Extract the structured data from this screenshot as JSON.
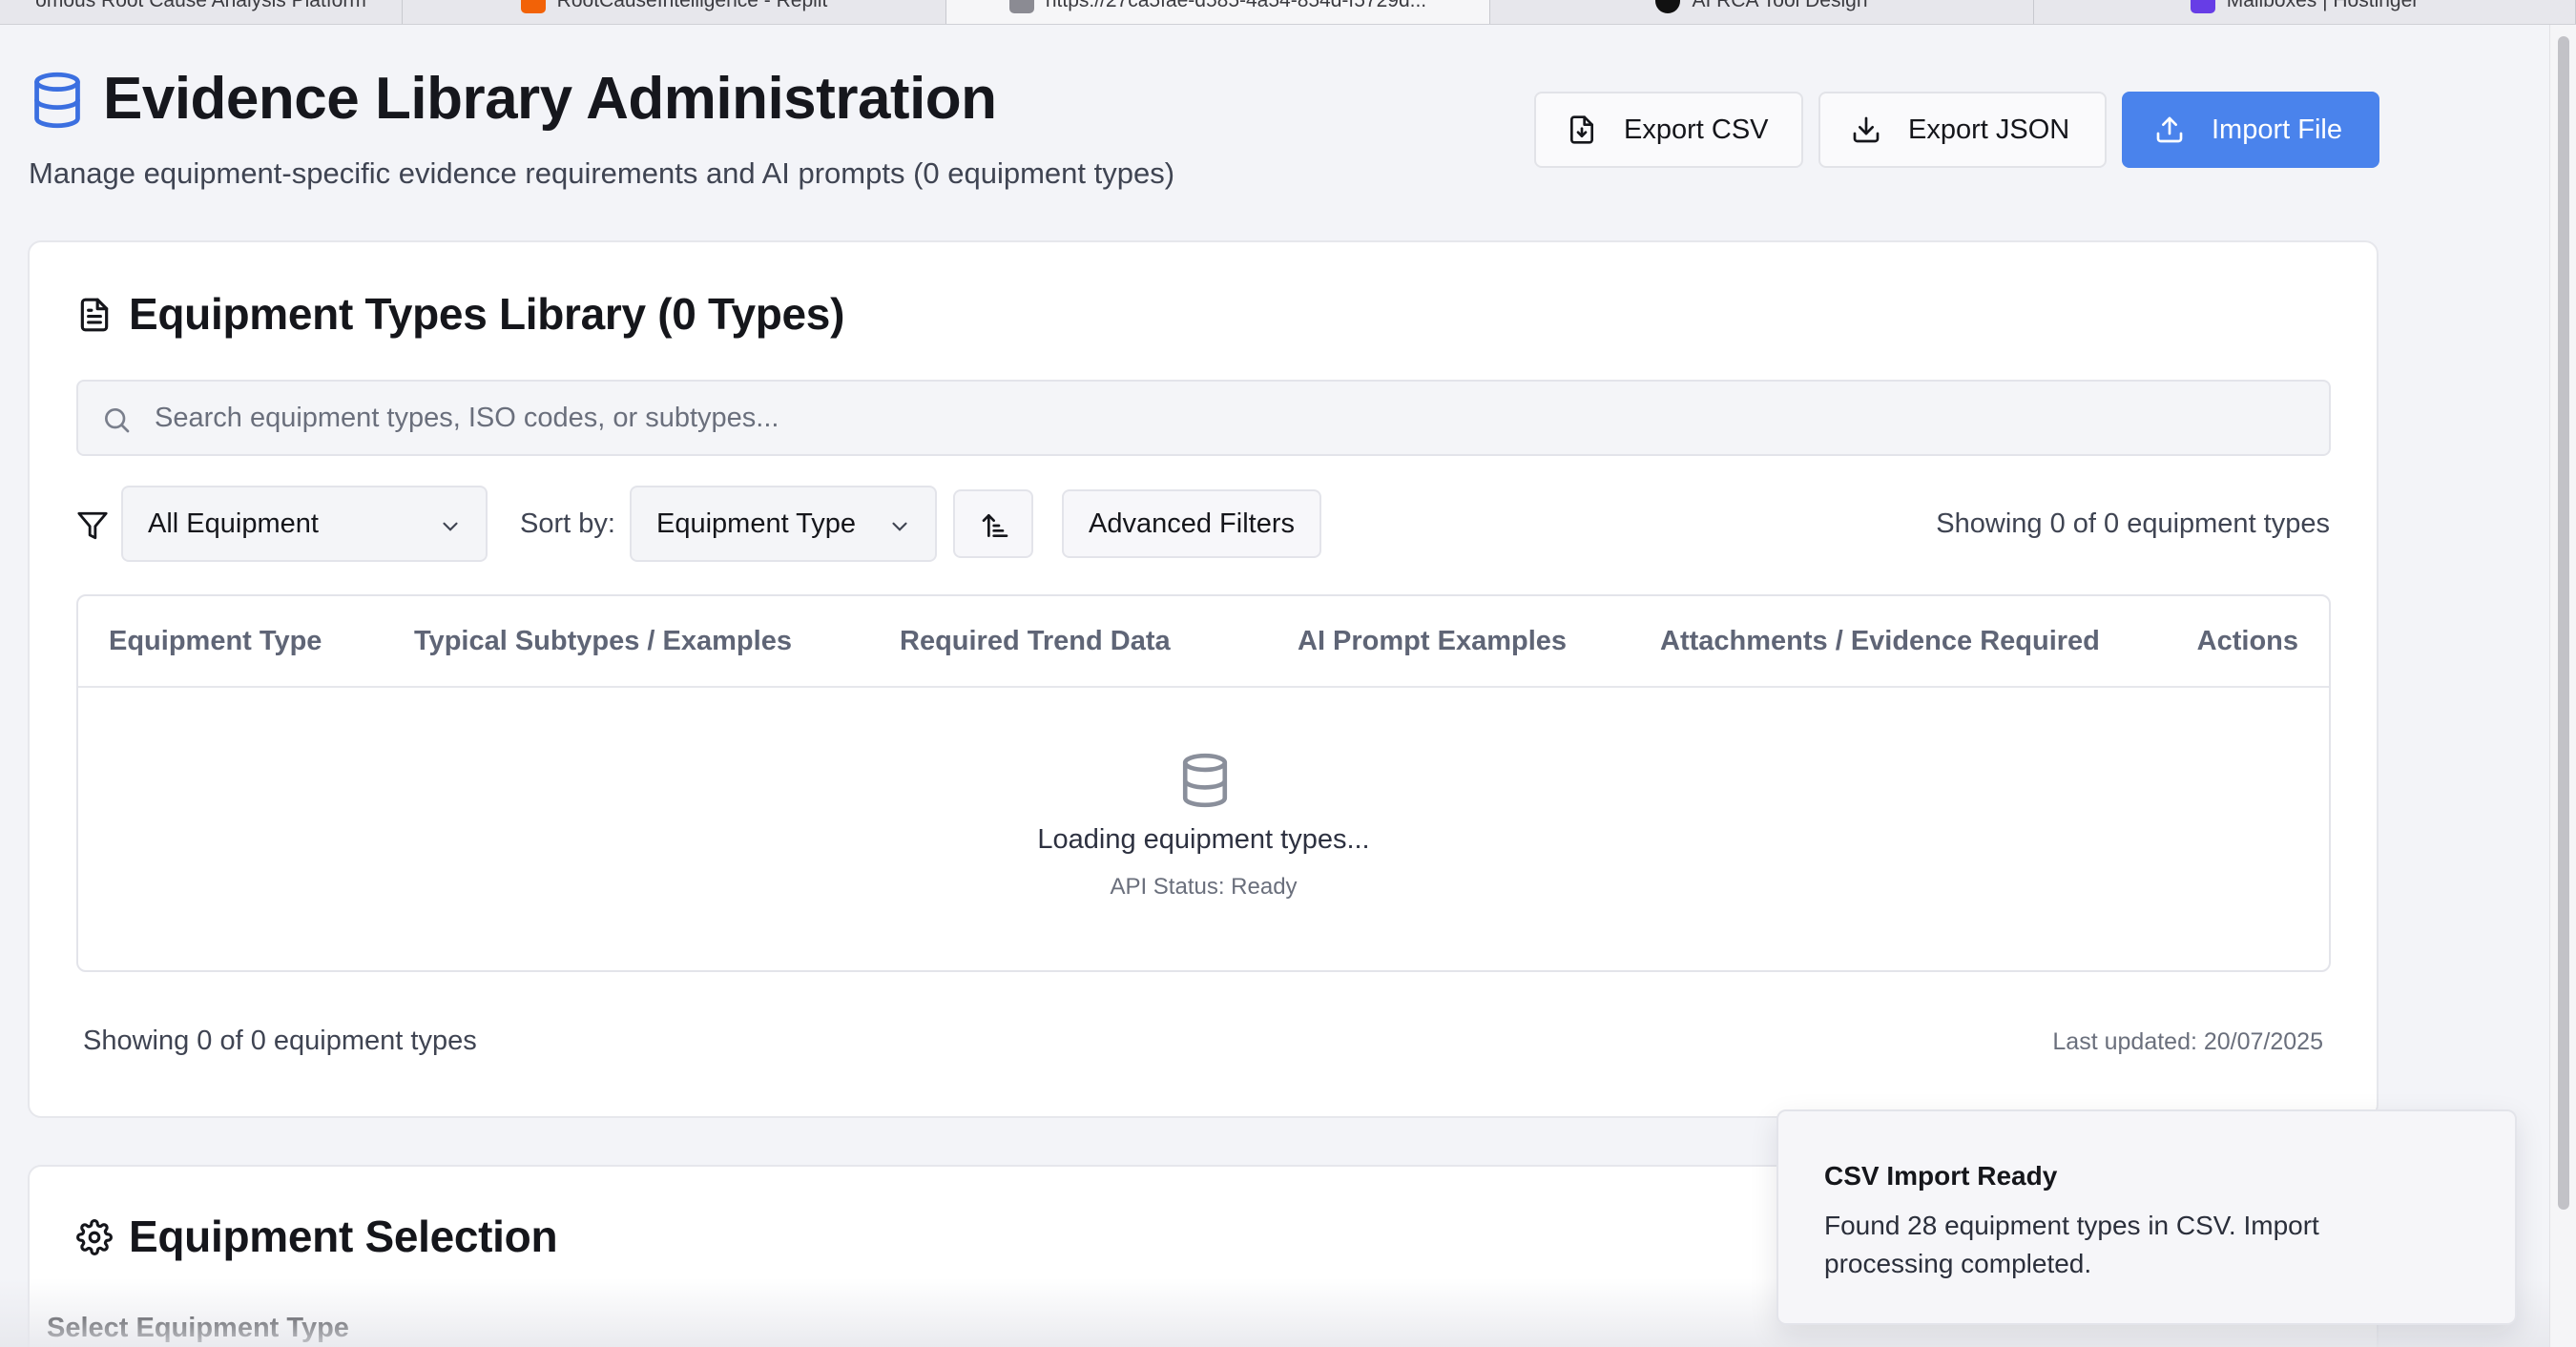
{
  "browser_tabs": [
    {
      "label": "omous Root Cause Analysis Platform",
      "active": false
    },
    {
      "label": "RootCauseIntelligence - Replit",
      "active": false
    },
    {
      "label": "https://27ca5fae-d585-4a54-854d-f5729d...",
      "active": true
    },
    {
      "label": "AI RCA Tool Design",
      "active": false
    },
    {
      "label": "Mailboxes | Hostinger",
      "active": false
    }
  ],
  "header": {
    "title": "Evidence Library Administration",
    "subtitle": "Manage equipment-specific evidence requirements and AI prompts (0 equipment types)",
    "icon": "database-icon",
    "buttons": {
      "export_csv": "Export CSV",
      "export_json": "Export JSON",
      "import_file": "Import File"
    }
  },
  "library": {
    "title": "Equipment Types Library (0 Types)",
    "search_placeholder": "Search equipment types, ISO codes, or subtypes...",
    "filter_value": "All Equipment",
    "sort_label": "Sort by:",
    "sort_value": "Equipment Type",
    "advanced_filters": "Advanced Filters",
    "showing_top": "Showing 0 of 0 equipment types",
    "columns": [
      "Equipment Type",
      "Typical Subtypes / Examples",
      "Required Trend Data",
      "AI Prompt Examples",
      "Attachments / Evidence Required",
      "Actions"
    ],
    "empty_message": "Loading equipment types...",
    "api_status": "API Status: Ready",
    "showing_bottom": "Showing 0 of 0 equipment types",
    "last_updated": "Last updated: 20/07/2025"
  },
  "equipment_selection": {
    "title": "Equipment Selection",
    "select_label": "Select Equipment Type"
  },
  "toast": {
    "title": "CSV Import Ready",
    "message": "Found 28 equipment types in CSV. Import processing completed."
  },
  "colors": {
    "primary": "#4a83ec",
    "page_bg": "#f3f4f8",
    "header_icon": "#3b6fe0"
  }
}
